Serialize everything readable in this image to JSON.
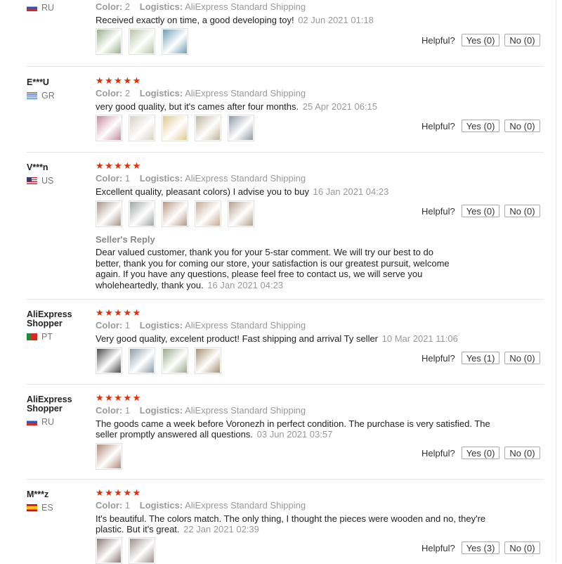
{
  "helpful_label": "Helpful?",
  "reviews": [
    {
      "user": "",
      "country": "RU",
      "flag": "ru",
      "color_label": "Color:",
      "color_value": "2",
      "logistics_label": "Logistics:",
      "logistics_value": "AliExpress Standard Shipping",
      "text": "Received exactly on time, a good developing toy!",
      "date": "02 Jun 2021 01:18",
      "images": [
        "#9ab08c",
        "#b7c4a5",
        "#6aa0b8"
      ],
      "yes": "Yes (0)",
      "no": "No (0)"
    },
    {
      "user": "E***U",
      "country": "GR",
      "flag": "gr",
      "stars": "★★★★★",
      "color_label": "Color:",
      "color_value": "2",
      "logistics_label": "Logistics:",
      "logistics_value": "AliExpress Standard Shipping",
      "text": "very good quality, but it's cames after four months.",
      "date": "25 Apr 2021 06:15",
      "images": [
        "#c58aa0",
        "#d8d0c4",
        "#e2c88e",
        "#c0b49a",
        "#8e9aa8"
      ],
      "yes": "Yes (0)",
      "no": "No (0)"
    },
    {
      "user": "V***n",
      "country": "US",
      "flag": "us",
      "stars": "★★★★★",
      "color_label": "Color:",
      "color_value": "1",
      "logistics_label": "Logistics:",
      "logistics_value": "AliExpress Standard Shipping",
      "text": "Excellent quality, pleasant colors) I advise you to buy",
      "date": "16 Jan 2021 04:23",
      "images": [
        "#a6948a",
        "#9ea4a2",
        "#b89684",
        "#c6aa92",
        "#b4a08c"
      ],
      "yes": "Yes (0)",
      "no": "No (0)",
      "reply_title": "Seller's Reply",
      "reply_text": "Dear valued customer, thank you for your 5-star comment. We will try our best to do better, thank you for coming our store, your satisfaction is our greatest pursuit, welcome again. If you have any questions, please feel free to contact us, we will serve you wholeheartedly, thank you.",
      "reply_date": "16 Jan 2021 04:23"
    },
    {
      "user": "AliExpress Shopper",
      "country": "PT",
      "flag": "pt",
      "stars": "★★★★★",
      "color_label": "Color:",
      "color_value": "1",
      "logistics_label": "Logistics:",
      "logistics_value": "AliExpress Standard Shipping",
      "text": "Very good quality, excelent product! Fast shipping and arrival Ty seller",
      "date": "10 Mar 2021 11:06",
      "images": [
        "#4a4a4a",
        "#8c9aa6",
        "#9aa88a",
        "#a89070"
      ],
      "yes": "Yes (1)",
      "no": "No (0)"
    },
    {
      "user": "AliExpress Shopper",
      "country": "RU",
      "flag": "ru",
      "stars": "★★★★★",
      "color_label": "Color:",
      "color_value": "1",
      "logistics_label": "Logistics:",
      "logistics_value": "AliExpress Standard Shipping",
      "text": "The goods came a week before Voronezh in perfect condition. The purchase is very satisfied. The seller promptly answered all questions.",
      "date": "03 Jun 2021 03:57",
      "images": [
        "#b08a78"
      ],
      "yes": "Yes (0)",
      "no": "No (0)"
    },
    {
      "user": "M***z",
      "country": "ES",
      "flag": "es",
      "stars": "★★★★★",
      "color_label": "Color:",
      "color_value": "1",
      "logistics_label": "Logistics:",
      "logistics_value": "AliExpress Standard Shipping",
      "text": "It's beautiful. The colors match. The only thing, I thought the pieces were wooden and no, they're plastic. But it's great.",
      "date": "22 Jan 2021 02:39",
      "images": [
        "#8a7a78",
        "#9a8e8c"
      ],
      "yes": "Yes (3)",
      "no": "No (0)"
    }
  ]
}
